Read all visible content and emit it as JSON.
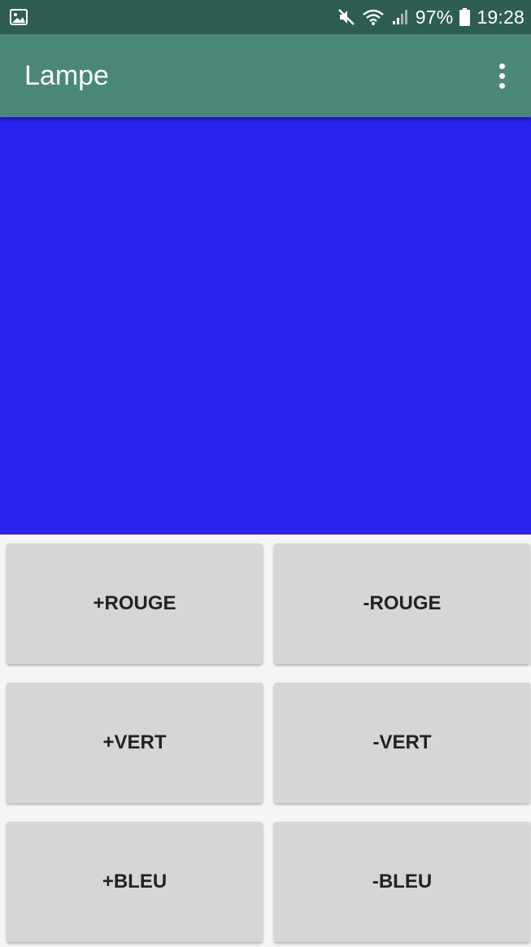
{
  "status_bar": {
    "icons": [
      "image-notification-icon",
      "mute-icon",
      "wifi-icon",
      "signal-icon",
      "battery-icon"
    ],
    "battery_percent": "97%",
    "time": "19:28"
  },
  "app_bar": {
    "title": "Lampe",
    "menu_icon": "overflow-menu-icon"
  },
  "colors": {
    "status_bar": "#2e5e51",
    "app_bar": "#4a8778",
    "lamp_color": "#2a23f0",
    "button_bg": "#d6d6d6"
  },
  "buttons": {
    "red_plus": "+ROUGE",
    "red_minus": "-ROUGE",
    "green_plus": "+VERT",
    "green_minus": "-VERT",
    "blue_plus": "+BLEU",
    "blue_minus": "-BLEU"
  }
}
